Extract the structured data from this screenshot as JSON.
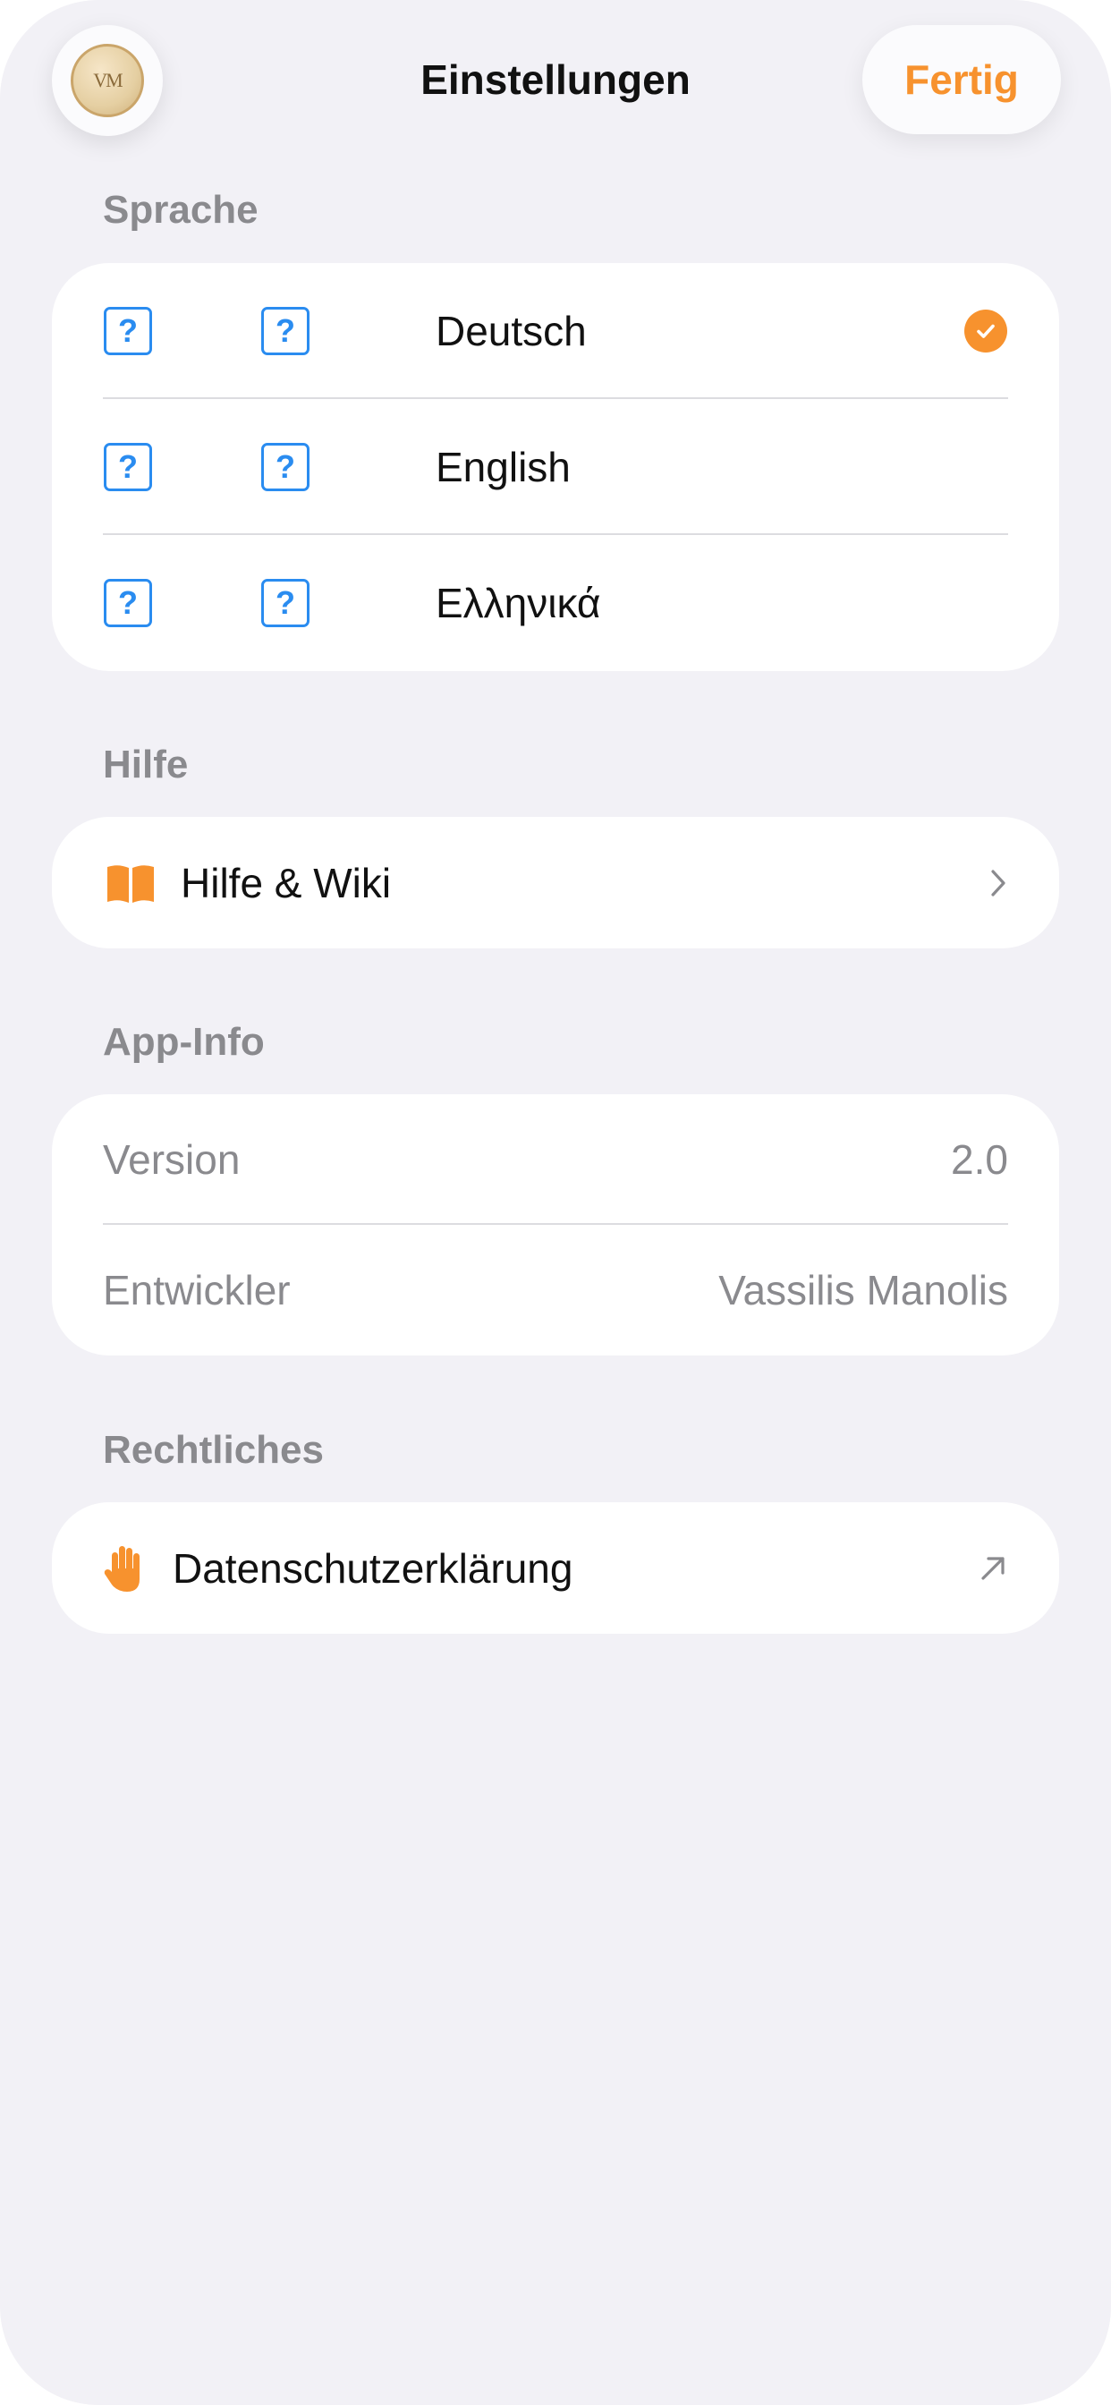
{
  "header": {
    "title": "Einstellungen",
    "done_label": "Fertig",
    "avatar_monogram": "VM"
  },
  "language_section": {
    "label": "Sprache",
    "items": [
      {
        "name": "Deutsch",
        "selected": true
      },
      {
        "name": "English",
        "selected": false
      },
      {
        "name": "Ελληνικά",
        "selected": false
      }
    ]
  },
  "help_section": {
    "label": "Hilfe",
    "item_label": "Hilfe & Wiki",
    "icon": "book-icon"
  },
  "app_info_section": {
    "label": "App-Info",
    "version_label": "Version",
    "version_value": "2.0",
    "developer_label": "Entwickler",
    "developer_value": "Vassilis Manolis"
  },
  "legal_section": {
    "label": "Rechtliches",
    "item_label": "Datenschutzerklärung",
    "icon": "hand-raised-icon"
  },
  "colors": {
    "accent": "#f7922e",
    "placeholder_icon": "#2a8cf0",
    "background": "#f2f1f6",
    "secondary_text": "#8a8a8e"
  }
}
